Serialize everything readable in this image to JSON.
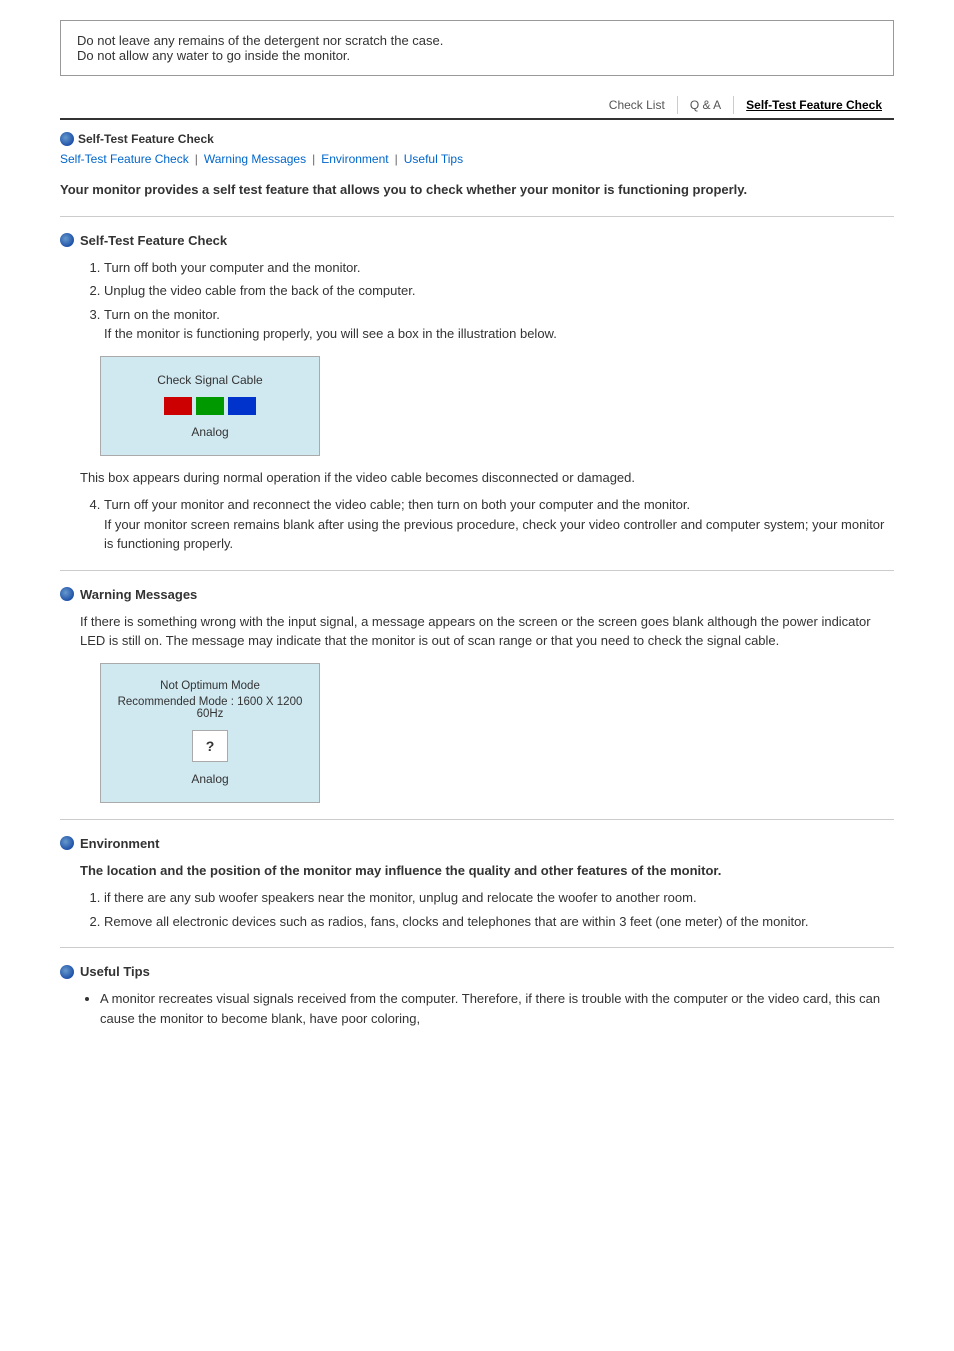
{
  "top_notice": {
    "line1": "Do not leave any remains of the detergent nor scratch the case.",
    "line2": "Do not allow any water to go inside the monitor."
  },
  "nav_tabs": [
    {
      "label": "Check List",
      "active": false
    },
    {
      "label": "Q & A",
      "active": false
    },
    {
      "label": "Self-Test Feature Check",
      "active": true
    }
  ],
  "breadcrumb": {
    "icon_alt": "bullet",
    "label": "Self-Test Feature Check"
  },
  "sub_nav": [
    {
      "label": "Self-Test Feature Check",
      "href": "#self-test"
    },
    {
      "label": "Warning Messages",
      "href": "#warning"
    },
    {
      "label": "Environment",
      "href": "#environment"
    },
    {
      "label": "Useful Tips",
      "href": "#useful-tips"
    }
  ],
  "intro_text": "Your monitor provides a self test feature that allows you to check whether your monitor is functioning properly.",
  "sections": {
    "self_test": {
      "title": "Self-Test Feature Check",
      "steps": [
        "Turn off both your computer and the monitor.",
        "Unplug the video cable from the back of the computer.",
        "Turn on the monitor.\nIf the monitor is functioning properly, you will see a box in the illustration below."
      ],
      "signal_box": {
        "title": "Check Signal Cable",
        "color_blocks": [
          "#cc0000",
          "#009900",
          "#0033cc"
        ],
        "analog_label": "Analog"
      },
      "note": "This box appears during normal operation if the video cable becomes disconnected or damaged.",
      "step4": "Turn off your monitor and reconnect the video cable; then turn on both your computer and the monitor.\nIf your monitor screen remains blank after using the previous procedure, check your video controller and computer system; your monitor is functioning properly."
    },
    "warning_messages": {
      "title": "Warning Messages",
      "description": "If there is something wrong with the input signal, a message appears on the screen or the screen goes blank although the power indicator LED is still on. The message may indicate that the monitor is out of scan range or that you need to check the signal cable.",
      "warning_box": {
        "line1": "Not Optimum Mode",
        "line2": "Recommended Mode : 1600 X 1200 60Hz",
        "question_symbol": "?",
        "analog_label": "Analog"
      }
    },
    "environment": {
      "title": "Environment",
      "bold_intro": "The location and the position of the monitor may influence the quality and other features of the monitor.",
      "items": [
        "if there are any sub woofer speakers near the monitor, unplug and relocate the woofer to another room.",
        "Remove all electronic devices such as radios, fans, clocks and telephones that are within 3 feet (one meter) of the monitor."
      ]
    },
    "useful_tips": {
      "title": "Useful Tips",
      "items": [
        "A monitor recreates visual signals received from the computer. Therefore, if there is trouble with the computer or the video card, this can cause the monitor to become blank, have poor coloring,"
      ]
    }
  }
}
